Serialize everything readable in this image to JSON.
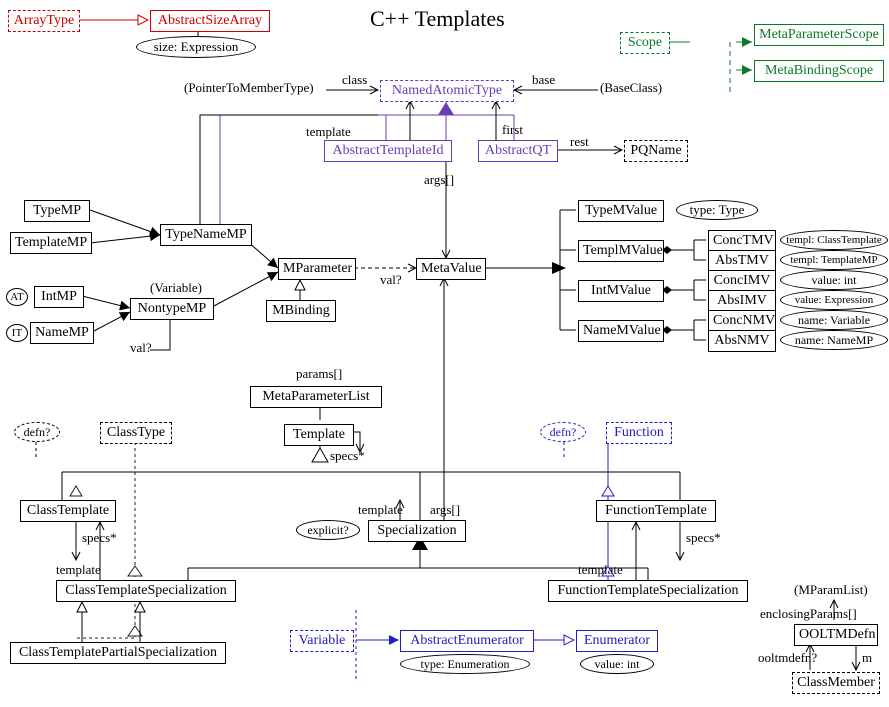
{
  "title": "C++ Templates",
  "boxes": {
    "ArrayType": "ArrayType",
    "AbstractSizeArray": "AbstractSizeArray",
    "Scope": "Scope",
    "MetaParameterScope": "MetaParameterScope",
    "MetaBindingScope": "MetaBindingScope",
    "NamedAtomicType": "NamedAtomicType",
    "AbstractTemplateId": "AbstractTemplateId",
    "AbstractQT": "AbstractQT",
    "PQName": "PQName",
    "TypeMP": "TypeMP",
    "TemplateMP": "TemplateMP",
    "IntMP": "IntMP",
    "NameMP": "NameMP",
    "TypeNameMP": "TypeNameMP",
    "NontypeMP": "NontypeMP",
    "MParameter": "MParameter",
    "MBinding": "MBinding",
    "MetaValue": "MetaValue",
    "TypeMValue": "TypeMValue",
    "TemplMValue": "TemplMValue",
    "IntMValue": "IntMValue",
    "NameMValue": "NameMValue",
    "ConcTMV": "ConcTMV",
    "AbsTMV": "AbsTMV",
    "ConcIMV": "ConcIMV",
    "AbsIMV": "AbsIMV",
    "ConcNMV": "ConcNMV",
    "AbsNMV": "AbsNMV",
    "MetaParameterList": "MetaParameterList",
    "Template": "Template",
    "ClassType": "ClassType",
    "Function": "Function",
    "ClassTemplate": "ClassTemplate",
    "FunctionTemplate": "FunctionTemplate",
    "Specialization": "Specialization",
    "ClassTemplateSpecialization": "ClassTemplateSpecialization",
    "FunctionTemplateSpecialization": "FunctionTemplateSpecialization",
    "ClassTemplatePartialSpecialization": "ClassTemplatePartialSpecialization",
    "Variable": "Variable",
    "AbstractEnumerator": "AbstractEnumerator",
    "Enumerator": "Enumerator",
    "OOLTMDefn": "OOLTMDefn",
    "ClassMember": "ClassMember"
  },
  "ovals": {
    "sizeExpression": "size: Expression",
    "typeType": "type: Type",
    "templClassTemplate": "templ: ClassTemplate",
    "templTemplateMP": "templ: TemplateMP",
    "valueInt": "value: int",
    "valueExpression": "value: Expression",
    "nameVariable": "name: Variable",
    "nameNameMP": "name: NameMP",
    "explicit": "explicit?",
    "defnL": "defn?",
    "defnR": "defn?",
    "typeEnumeration": "type: Enumeration",
    "valueIntEnum": "value: int",
    "AT": "AT",
    "IT": "IT"
  },
  "labels": {
    "PointerToMemberType": "(PointerToMemberType)",
    "class": "class",
    "base": "base",
    "BaseClass": "(BaseClass)",
    "template_top": "template",
    "first": "first",
    "rest": "rest",
    "args_top": "args[]",
    "VariableParen": "(Variable)",
    "valQ_left": "val?",
    "valQ_mid": "val?",
    "params": "params[]",
    "specs_star_mid": "specs*",
    "specs_star_left": "specs*",
    "specs_star_right": "specs*",
    "template_left": "template",
    "template_mid": "template",
    "template_right": "template",
    "args_mid": "args[]",
    "MParamList": "(MParamList)",
    "enclosingParams": "enclosingParams[]",
    "ooltmdefnQ": "ooltmdefn?",
    "m": "m"
  }
}
